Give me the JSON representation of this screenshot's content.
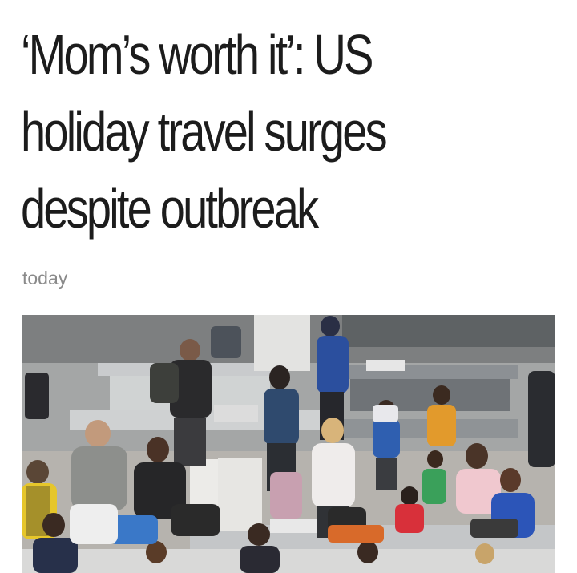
{
  "article": {
    "headline_lines": [
      "‘Mom’s worth it’: US",
      "holiday travel surges",
      "despite outbreak"
    ],
    "dateline": "today"
  },
  "photo": {
    "subject": "airport-security-checkpoint-crowd"
  },
  "colors": {
    "headline": "#1c1c1c",
    "dateline": "#8a8a8a",
    "background": "#ffffff"
  }
}
